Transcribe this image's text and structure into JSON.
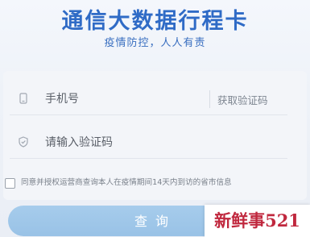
{
  "header": {
    "title": "通信大数据行程卡",
    "subtitle": "疫情防控，人人有责"
  },
  "form": {
    "phone": {
      "icon": "phone-icon",
      "placeholder": "手机号",
      "value": ""
    },
    "get_code_label": "获取验证码",
    "code": {
      "icon": "shield-icon",
      "placeholder": "请输入验证码",
      "value": ""
    },
    "agreement": {
      "checked": false,
      "text": "同意并授权运营商查询本人在疫情期间14天内到访的省市信息"
    },
    "submit_label": "查询"
  },
  "watermark": {
    "text": "新鲜事521"
  },
  "colors": {
    "title": "#2f6bc6",
    "button": "#a6ccec",
    "watermark": "#c0283e"
  }
}
